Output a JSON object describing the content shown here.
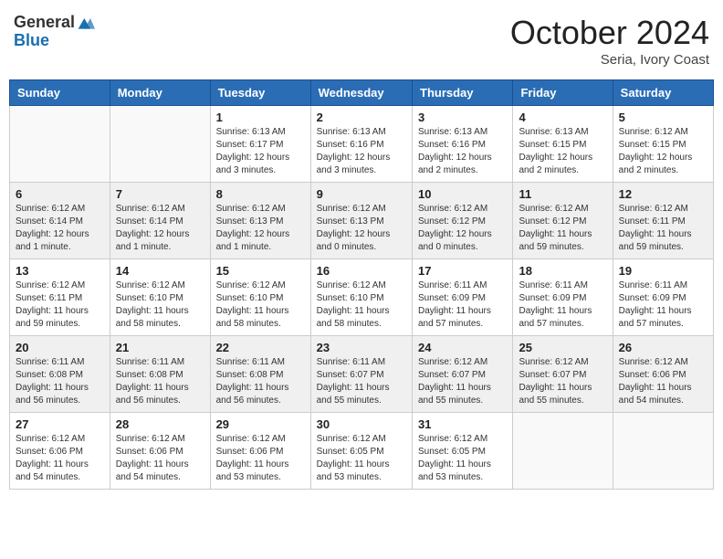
{
  "header": {
    "logo_general": "General",
    "logo_blue": "Blue",
    "month_title": "October 2024",
    "location": "Seria, Ivory Coast"
  },
  "weekdays": [
    "Sunday",
    "Monday",
    "Tuesday",
    "Wednesday",
    "Thursday",
    "Friday",
    "Saturday"
  ],
  "weeks": [
    [
      {
        "day": "",
        "info": ""
      },
      {
        "day": "",
        "info": ""
      },
      {
        "day": "1",
        "info": "Sunrise: 6:13 AM\nSunset: 6:17 PM\nDaylight: 12 hours and 3 minutes."
      },
      {
        "day": "2",
        "info": "Sunrise: 6:13 AM\nSunset: 6:16 PM\nDaylight: 12 hours and 3 minutes."
      },
      {
        "day": "3",
        "info": "Sunrise: 6:13 AM\nSunset: 6:16 PM\nDaylight: 12 hours and 2 minutes."
      },
      {
        "day": "4",
        "info": "Sunrise: 6:13 AM\nSunset: 6:15 PM\nDaylight: 12 hours and 2 minutes."
      },
      {
        "day": "5",
        "info": "Sunrise: 6:12 AM\nSunset: 6:15 PM\nDaylight: 12 hours and 2 minutes."
      }
    ],
    [
      {
        "day": "6",
        "info": "Sunrise: 6:12 AM\nSunset: 6:14 PM\nDaylight: 12 hours and 1 minute."
      },
      {
        "day": "7",
        "info": "Sunrise: 6:12 AM\nSunset: 6:14 PM\nDaylight: 12 hours and 1 minute."
      },
      {
        "day": "8",
        "info": "Sunrise: 6:12 AM\nSunset: 6:13 PM\nDaylight: 12 hours and 1 minute."
      },
      {
        "day": "9",
        "info": "Sunrise: 6:12 AM\nSunset: 6:13 PM\nDaylight: 12 hours and 0 minutes."
      },
      {
        "day": "10",
        "info": "Sunrise: 6:12 AM\nSunset: 6:12 PM\nDaylight: 12 hours and 0 minutes."
      },
      {
        "day": "11",
        "info": "Sunrise: 6:12 AM\nSunset: 6:12 PM\nDaylight: 11 hours and 59 minutes."
      },
      {
        "day": "12",
        "info": "Sunrise: 6:12 AM\nSunset: 6:11 PM\nDaylight: 11 hours and 59 minutes."
      }
    ],
    [
      {
        "day": "13",
        "info": "Sunrise: 6:12 AM\nSunset: 6:11 PM\nDaylight: 11 hours and 59 minutes."
      },
      {
        "day": "14",
        "info": "Sunrise: 6:12 AM\nSunset: 6:10 PM\nDaylight: 11 hours and 58 minutes."
      },
      {
        "day": "15",
        "info": "Sunrise: 6:12 AM\nSunset: 6:10 PM\nDaylight: 11 hours and 58 minutes."
      },
      {
        "day": "16",
        "info": "Sunrise: 6:12 AM\nSunset: 6:10 PM\nDaylight: 11 hours and 58 minutes."
      },
      {
        "day": "17",
        "info": "Sunrise: 6:11 AM\nSunset: 6:09 PM\nDaylight: 11 hours and 57 minutes."
      },
      {
        "day": "18",
        "info": "Sunrise: 6:11 AM\nSunset: 6:09 PM\nDaylight: 11 hours and 57 minutes."
      },
      {
        "day": "19",
        "info": "Sunrise: 6:11 AM\nSunset: 6:09 PM\nDaylight: 11 hours and 57 minutes."
      }
    ],
    [
      {
        "day": "20",
        "info": "Sunrise: 6:11 AM\nSunset: 6:08 PM\nDaylight: 11 hours and 56 minutes."
      },
      {
        "day": "21",
        "info": "Sunrise: 6:11 AM\nSunset: 6:08 PM\nDaylight: 11 hours and 56 minutes."
      },
      {
        "day": "22",
        "info": "Sunrise: 6:11 AM\nSunset: 6:08 PM\nDaylight: 11 hours and 56 minutes."
      },
      {
        "day": "23",
        "info": "Sunrise: 6:11 AM\nSunset: 6:07 PM\nDaylight: 11 hours and 55 minutes."
      },
      {
        "day": "24",
        "info": "Sunrise: 6:12 AM\nSunset: 6:07 PM\nDaylight: 11 hours and 55 minutes."
      },
      {
        "day": "25",
        "info": "Sunrise: 6:12 AM\nSunset: 6:07 PM\nDaylight: 11 hours and 55 minutes."
      },
      {
        "day": "26",
        "info": "Sunrise: 6:12 AM\nSunset: 6:06 PM\nDaylight: 11 hours and 54 minutes."
      }
    ],
    [
      {
        "day": "27",
        "info": "Sunrise: 6:12 AM\nSunset: 6:06 PM\nDaylight: 11 hours and 54 minutes."
      },
      {
        "day": "28",
        "info": "Sunrise: 6:12 AM\nSunset: 6:06 PM\nDaylight: 11 hours and 54 minutes."
      },
      {
        "day": "29",
        "info": "Sunrise: 6:12 AM\nSunset: 6:06 PM\nDaylight: 11 hours and 53 minutes."
      },
      {
        "day": "30",
        "info": "Sunrise: 6:12 AM\nSunset: 6:05 PM\nDaylight: 11 hours and 53 minutes."
      },
      {
        "day": "31",
        "info": "Sunrise: 6:12 AM\nSunset: 6:05 PM\nDaylight: 11 hours and 53 minutes."
      },
      {
        "day": "",
        "info": ""
      },
      {
        "day": "",
        "info": ""
      }
    ]
  ]
}
